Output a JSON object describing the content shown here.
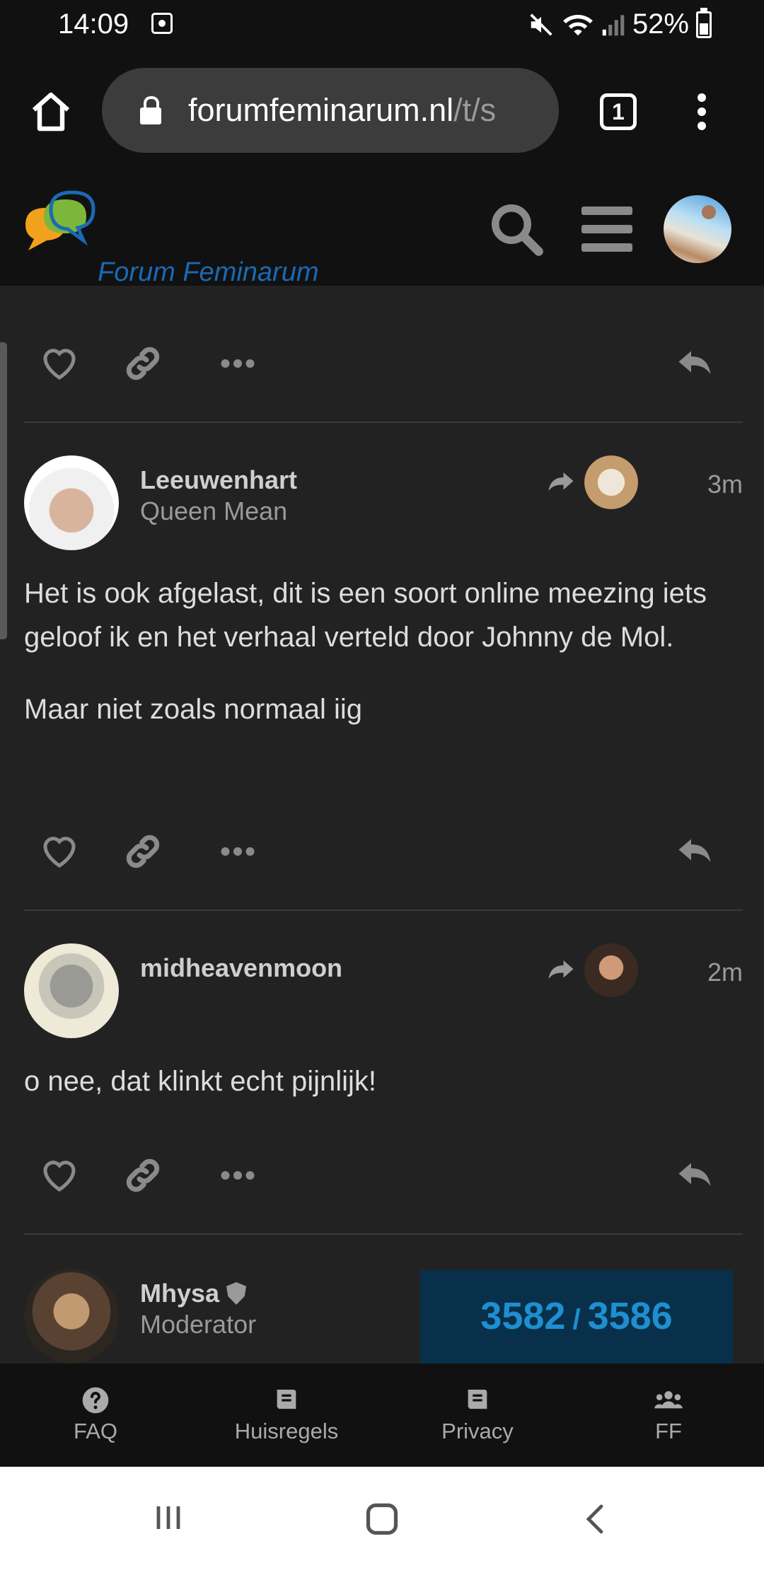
{
  "status_bar": {
    "time": "14:09",
    "battery": "52%"
  },
  "browser": {
    "url_domain": "forumfeminarum.nl",
    "url_path": "/t/s",
    "tab_count": "1"
  },
  "site": {
    "name": "Forum Feminarum"
  },
  "posts": [
    {
      "username": "Leeuwenhart",
      "user_title": "Queen Mean",
      "time": "3m",
      "paragraphs": [
        "Het is ook afgelast, dit is een soort online meezing iets geloof ik en het verhaal verteld door Johnny de Mol.",
        "Maar niet zoals normaal iig"
      ]
    },
    {
      "username": "midheavenmoon",
      "user_title": "",
      "time": "2m",
      "paragraphs": [
        "o nee, dat klinkt echt pijnlijk!"
      ]
    },
    {
      "username": "Mhysa",
      "user_title": "Moderator"
    }
  ],
  "progress": {
    "current": "3582",
    "separator": "/",
    "total": "3586"
  },
  "footer_nav": [
    {
      "label": "FAQ",
      "icon": "question-circle-icon"
    },
    {
      "label": "Huisregels",
      "icon": "book-icon"
    },
    {
      "label": "Privacy",
      "icon": "book-icon"
    },
    {
      "label": "FF",
      "icon": "users-icon"
    }
  ],
  "colors": {
    "background": "#222222",
    "header": "#111111",
    "accent": "#1e8fd0",
    "logo_text": "#1a6ab5"
  }
}
